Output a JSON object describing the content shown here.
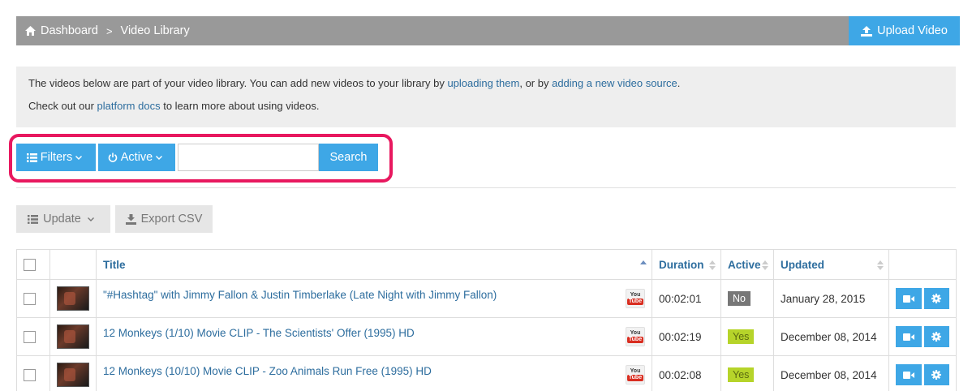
{
  "breadcrumb": {
    "home": "Dashboard",
    "separator": ">",
    "current": "Video Library"
  },
  "header": {
    "upload_label": "Upload Video"
  },
  "info": {
    "line1_pre": "The videos below are part of your video library. You can add new videos to your library by ",
    "line1_link1": "uploading them",
    "line1_mid": ", or by ",
    "line1_link2": "adding a new video source",
    "line1_post": ".",
    "line2_pre": "Check out our ",
    "line2_link": "platform docs",
    "line2_post": " to learn more about using videos."
  },
  "filters": {
    "filters_label": "Filters",
    "active_label": "Active",
    "search_value": "",
    "search_label": "Search"
  },
  "actions": {
    "update_label": "Update",
    "export_label": "Export CSV"
  },
  "table": {
    "columns": {
      "title": "Title",
      "duration": "Duration",
      "active": "Active",
      "updated": "Updated"
    },
    "rows": [
      {
        "title": "\"#Hashtag\" with Jimmy Fallon & Justin Timberlake (Late Night with Jimmy Fallon)",
        "source": "YouTube",
        "duration": "00:02:01",
        "active": "No",
        "updated": "January 28, 2015"
      },
      {
        "title": "12 Monkeys (1/10) Movie CLIP - The Scientists' Offer (1995) HD",
        "source": "YouTube",
        "duration": "00:02:19",
        "active": "Yes",
        "updated": "December 08, 2014"
      },
      {
        "title": "12 Monkeys (10/10) Movie CLIP - Zoo Animals Run Free (1995) HD",
        "source": "YouTube",
        "duration": "00:02:08",
        "active": "Yes",
        "updated": "December 08, 2014"
      }
    ]
  },
  "youtube_badge": {
    "top": "You",
    "bottom": "Tube"
  },
  "colors": {
    "accent": "#3ea7e6",
    "topbar": "#999999",
    "highlight": "#e8185f",
    "badge_yes": "#b6d42a",
    "badge_no": "#777777",
    "link": "#2d6d9e"
  },
  "icons": {
    "home": "home-icon",
    "upload": "upload-icon",
    "filters": "list-icon",
    "active": "power-icon",
    "update": "list-icon",
    "export": "download-icon",
    "row_video": "video-camera-icon",
    "row_settings": "gear-icon"
  }
}
